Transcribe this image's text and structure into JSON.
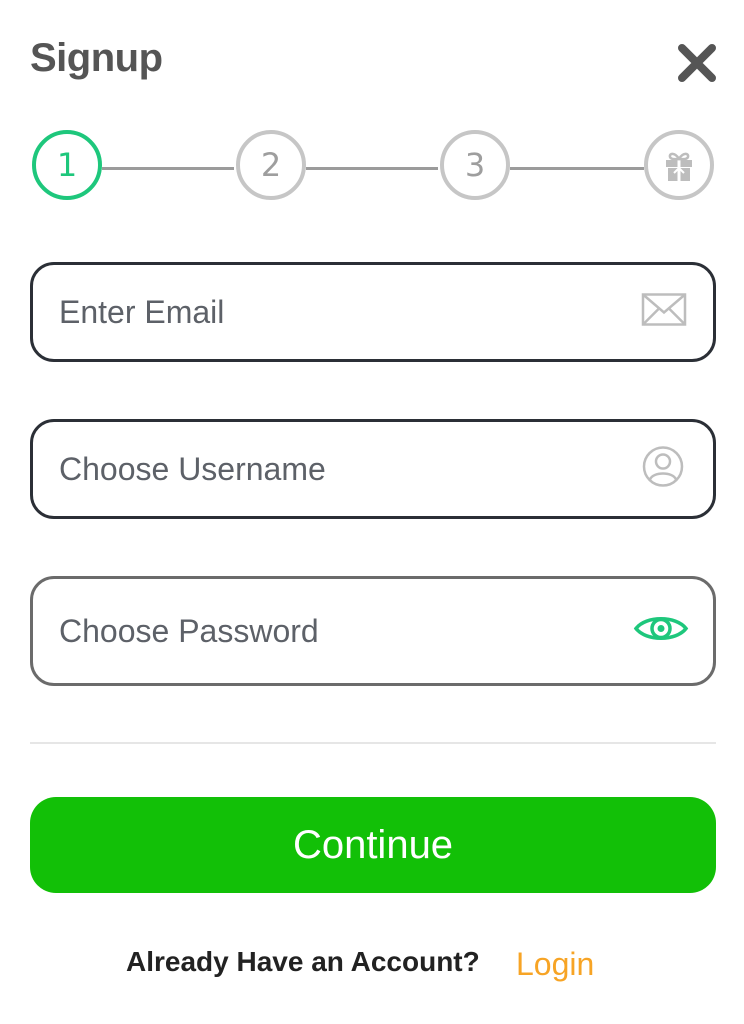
{
  "header": {
    "title": "Signup",
    "close_icon": "close-icon"
  },
  "stepper": {
    "steps": [
      {
        "label": "1",
        "state": "active"
      },
      {
        "label": "2",
        "state": "inactive"
      },
      {
        "label": "3",
        "state": "inactive"
      },
      {
        "label": "",
        "icon": "gift-icon",
        "state": "inactive"
      }
    ],
    "active_color": "#1ec77c",
    "inactive_color": "#c6c6c6"
  },
  "form": {
    "email": {
      "placeholder": "Enter Email",
      "value": "",
      "icon": "envelope-icon"
    },
    "username": {
      "placeholder": "Choose Username",
      "value": "",
      "icon": "user-icon"
    },
    "password": {
      "placeholder": "Choose Password",
      "value": "",
      "icon": "eye-icon",
      "icon_color": "#1ec77c"
    }
  },
  "actions": {
    "continue_label": "Continue",
    "continue_color": "#12c007"
  },
  "footer": {
    "question": "Already Have an Account?",
    "login_label": "Login",
    "login_color": "#f7a425"
  }
}
